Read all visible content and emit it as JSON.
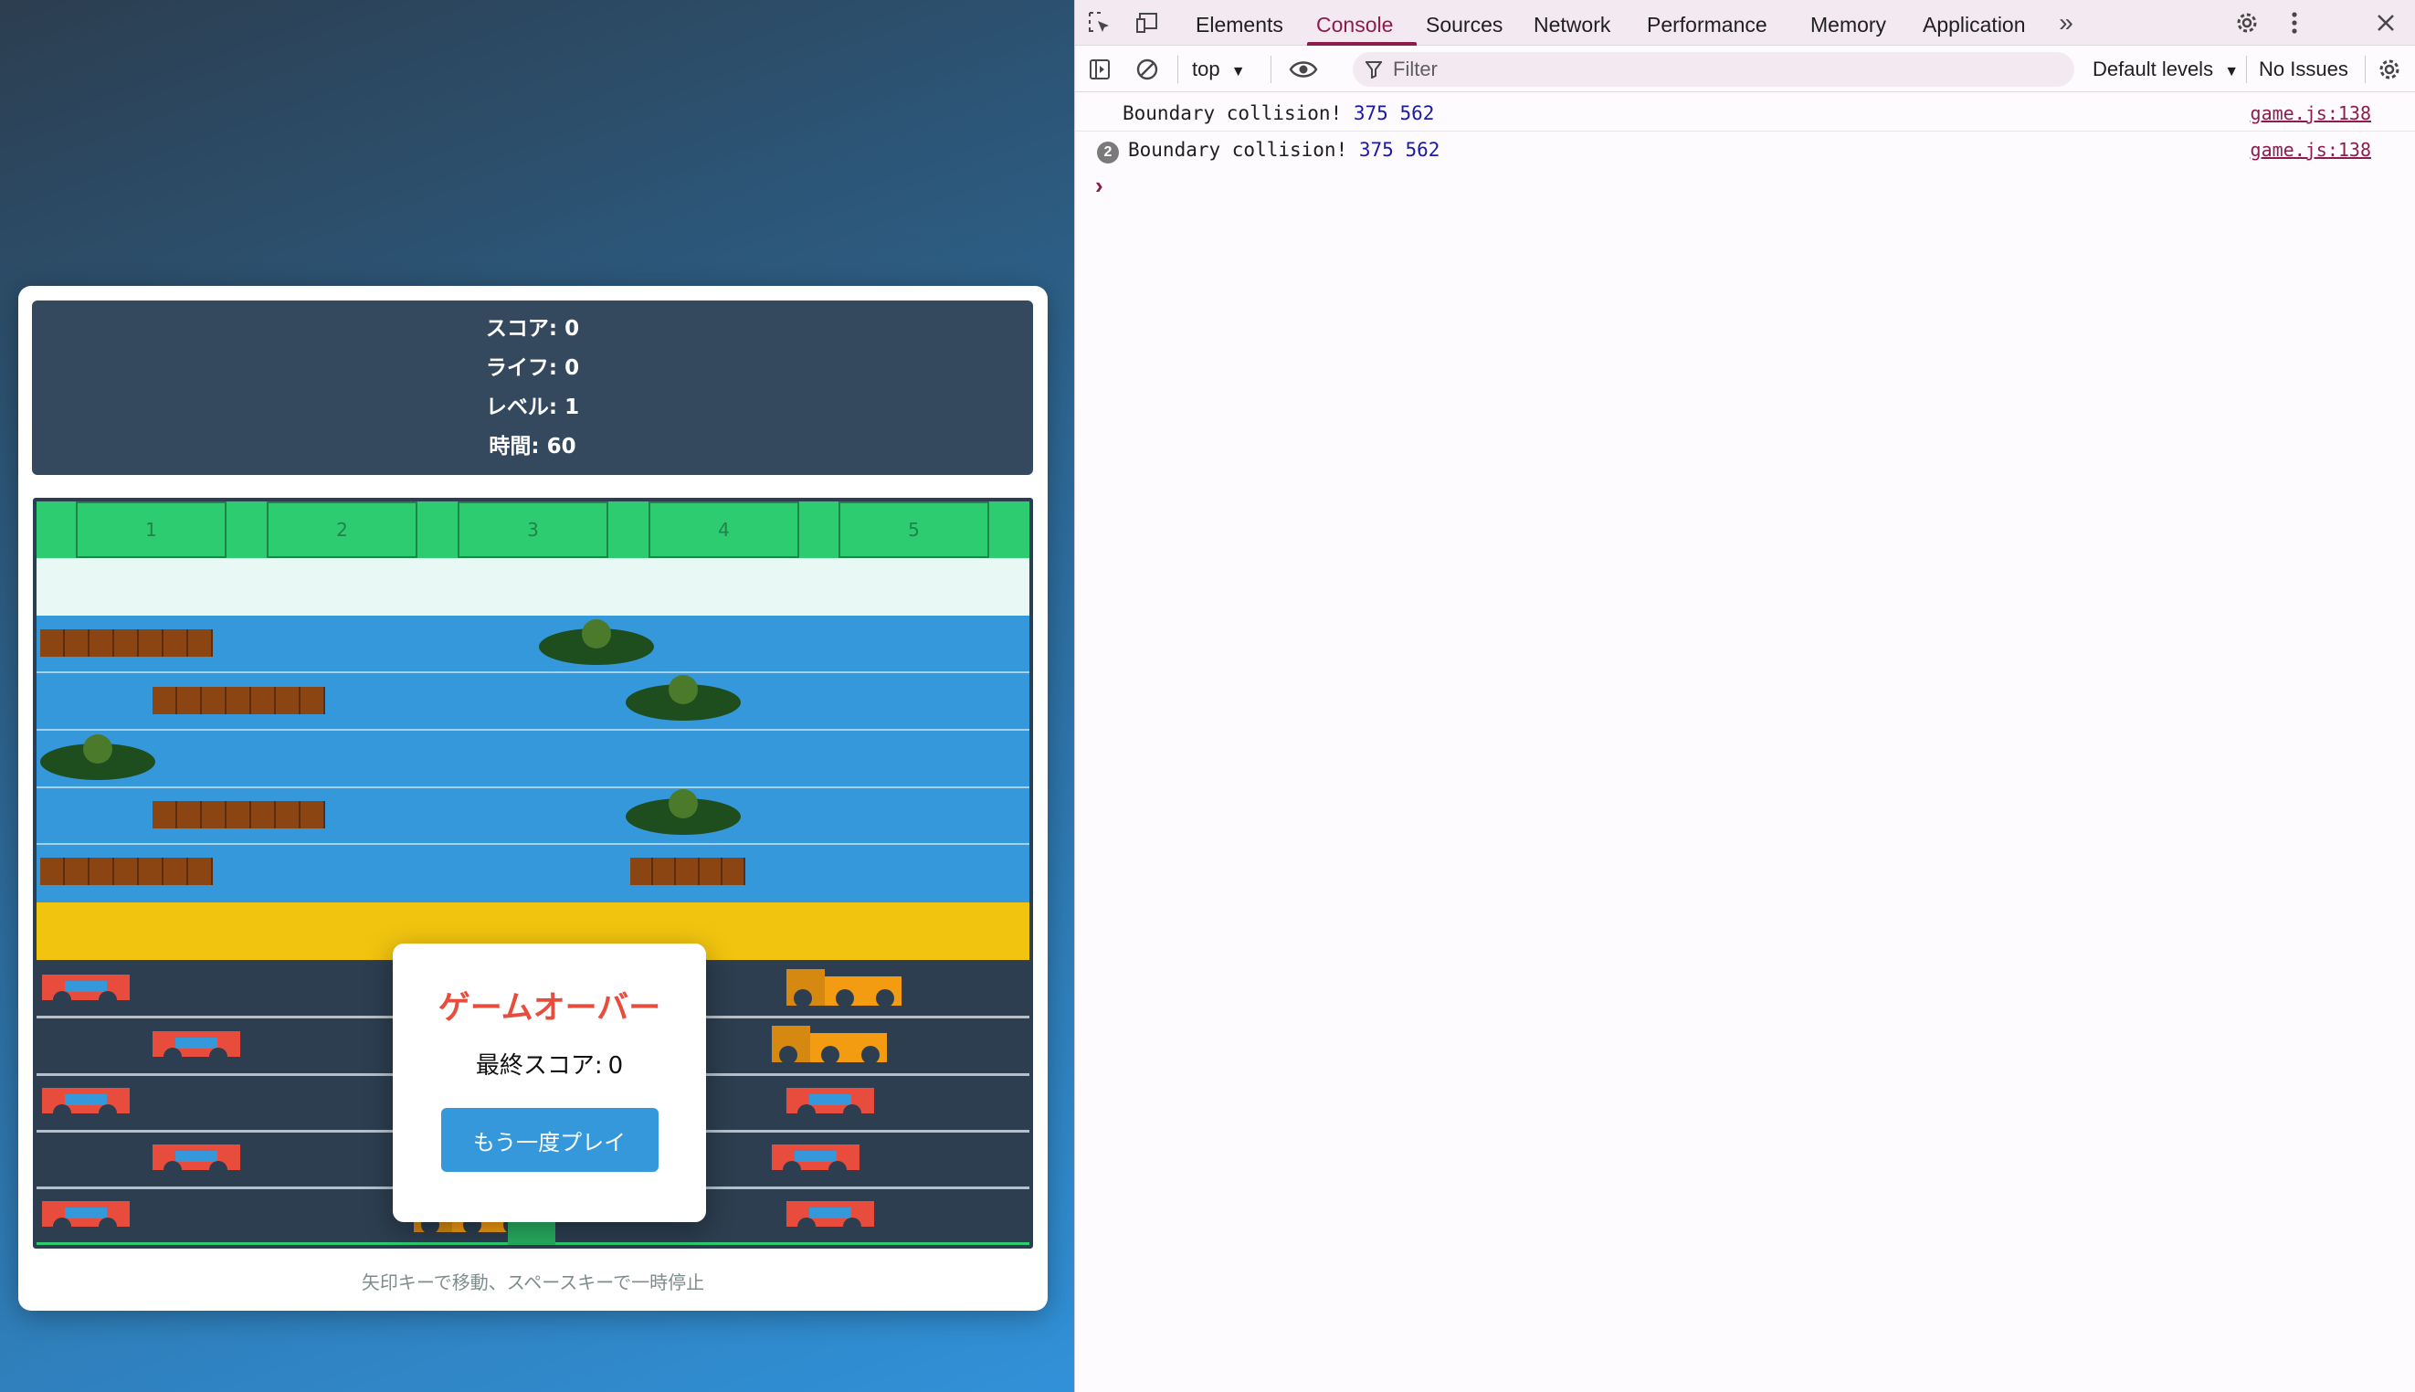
{
  "game": {
    "score_label": "スコア:",
    "score": "0",
    "lives_label": "ライフ:",
    "lives": "0",
    "level_label": "レベル:",
    "level": "1",
    "time_label": "時間:",
    "time": "60",
    "goal_slots": [
      "1",
      "2",
      "3",
      "4",
      "5"
    ],
    "instructions": "矢印キーで移動、スペースキーで一時停止",
    "colors": {
      "goal": "#2ecc71",
      "safe_top": "#e8f8f5",
      "water": "#3498db",
      "median": "#f1c40f",
      "road": "#2c3e50"
    }
  },
  "modal": {
    "title": "ゲームオーバー",
    "score_label": "最終スコア:",
    "score": "0",
    "button": "もう一度プレイ"
  },
  "devtools": {
    "tabs": [
      "Elements",
      "Console",
      "Sources",
      "Network",
      "Performance",
      "Memory",
      "Application"
    ],
    "active_tab": "Console",
    "context": "top",
    "filter_placeholder": "Filter",
    "levels": "Default levels",
    "issues": "No Issues",
    "messages": [
      {
        "count": "",
        "text": "Boundary collision!",
        "a": "375",
        "b": "562",
        "source": "game.js:138"
      },
      {
        "count": "2",
        "text": "Boundary collision!",
        "a": "375",
        "b": "562",
        "source": "game.js:138"
      }
    ],
    "prompt": "›"
  }
}
